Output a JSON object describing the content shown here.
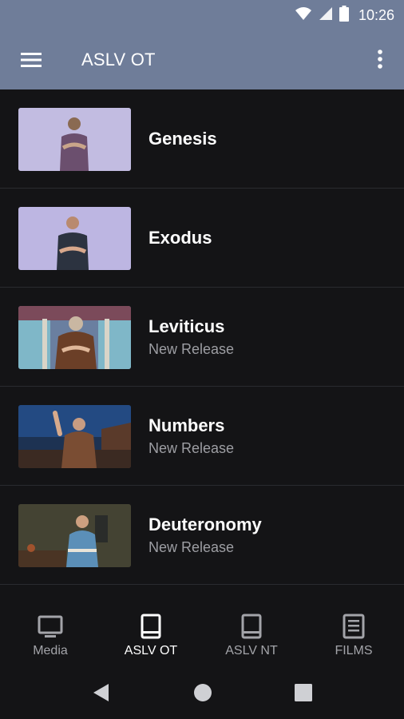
{
  "status_bar": {
    "time": "10:26"
  },
  "app_bar": {
    "title": "ASLV OT",
    "menu_icon": "hamburger-menu-icon",
    "overflow_icon": "more-vert-icon"
  },
  "books": [
    {
      "title": "Genesis",
      "subtitle": ""
    },
    {
      "title": "Exodus",
      "subtitle": ""
    },
    {
      "title": "Leviticus",
      "subtitle": "New Release"
    },
    {
      "title": "Numbers",
      "subtitle": "New Release"
    },
    {
      "title": "Deuteronomy",
      "subtitle": "New Release"
    }
  ],
  "bottom_nav": [
    {
      "label": "Media",
      "icon": "tv-icon",
      "active": false
    },
    {
      "label": "ASLV OT",
      "icon": "book-icon",
      "active": true
    },
    {
      "label": "ASLV NT",
      "icon": "book-icon",
      "active": false
    },
    {
      "label": "FILMS",
      "icon": "film-list-icon",
      "active": false
    }
  ],
  "colors": {
    "app_bar": "#6f7d99",
    "background": "#141416",
    "active_label": "#ffffff",
    "inactive_label": "#a3a4a9"
  }
}
